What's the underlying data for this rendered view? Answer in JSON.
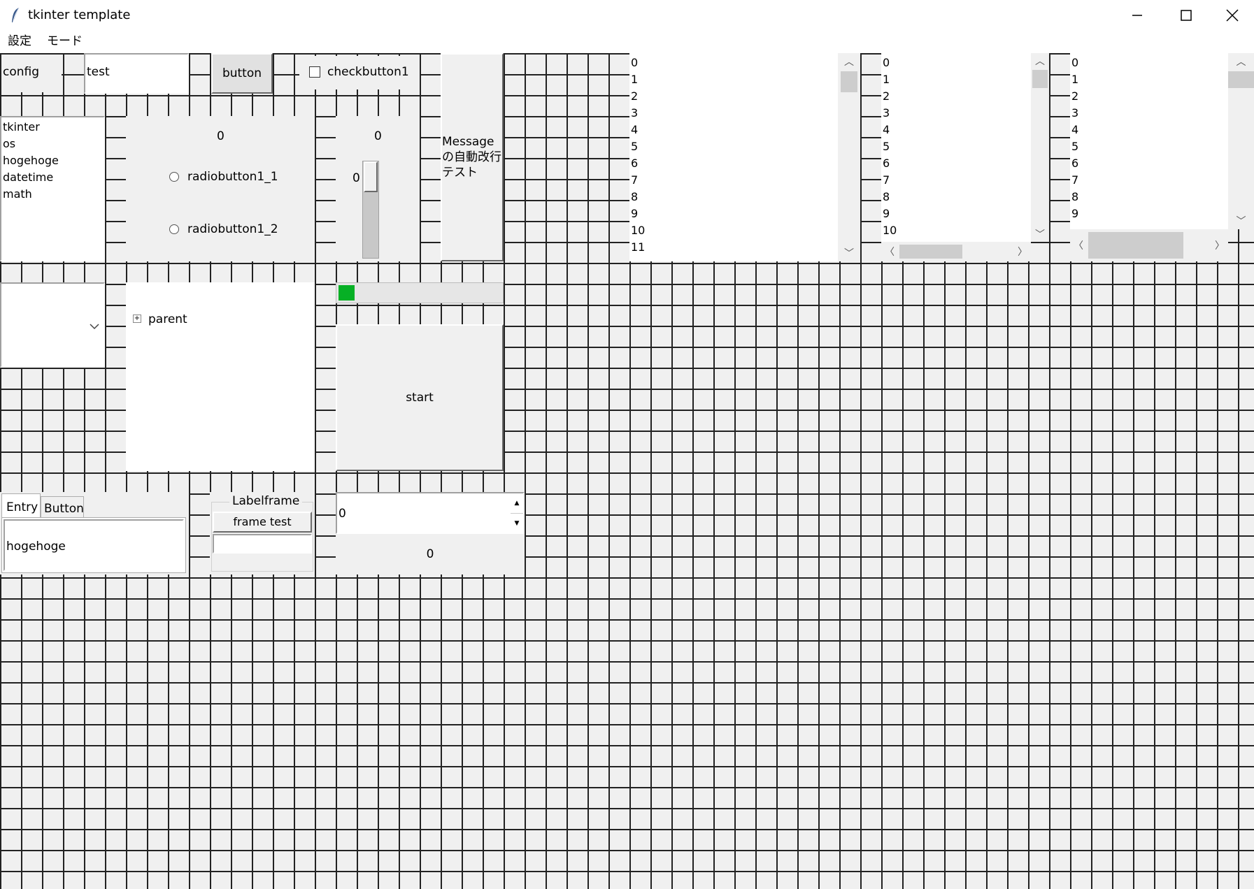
{
  "window": {
    "title": "tkinter template"
  },
  "menu": [
    "設定",
    "モード"
  ],
  "row1": {
    "config_label": "config",
    "entry_value": "test",
    "button_label": "button",
    "checkbutton_label": "checkbutton1",
    "message_text": "Messageの自動改行テスト"
  },
  "listbox_modules": [
    "tkinter",
    "os",
    "hogehoge",
    "datetime",
    "math"
  ],
  "radio": {
    "value_label": "0",
    "option1": "radiobutton1_1",
    "option2": "radiobutton1_2"
  },
  "scale": {
    "top_label": "0",
    "value_label": "0",
    "level": 0
  },
  "listbox_numbers": {
    "list1": [
      "0",
      "1",
      "2",
      "3",
      "4",
      "5",
      "6",
      "7",
      "8",
      "9",
      "10",
      "11"
    ],
    "list2": [
      "0",
      "1",
      "2",
      "3",
      "4",
      "5",
      "6",
      "7",
      "8",
      "9",
      "10"
    ],
    "list3": [
      "0",
      "1",
      "2",
      "3",
      "4",
      "5",
      "6",
      "7",
      "8",
      "9"
    ]
  },
  "combobox": {
    "value": ""
  },
  "tree": {
    "root_label": "parent"
  },
  "progress": {
    "fraction": 0.1,
    "color": "#06b025"
  },
  "start_button": "start",
  "notebook": {
    "tabs": [
      "Entry",
      "Button"
    ],
    "entry_value": "hogehoge"
  },
  "labelframe": {
    "title": "Labelframe",
    "button_label": "frame test",
    "entry_value": ""
  },
  "spinbox": {
    "value": "0",
    "label_value": "0"
  },
  "icons": {
    "app": "feather-icon",
    "minimize": "minimize-icon",
    "maximize": "maximize-icon",
    "close": "close-icon",
    "expand": "plus-box-icon"
  }
}
